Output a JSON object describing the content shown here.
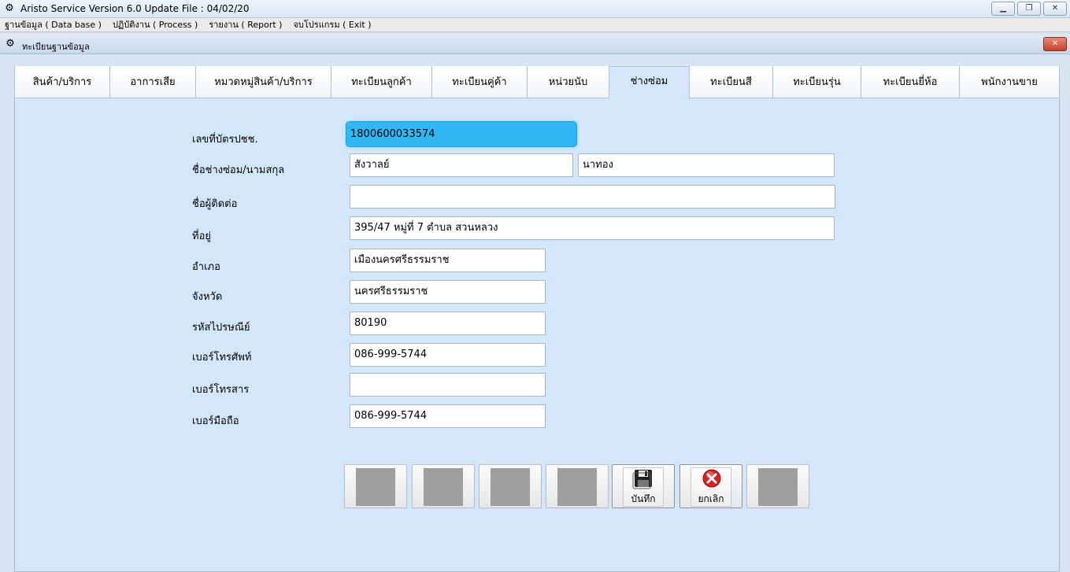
{
  "window": {
    "title": "Aristo Service Version 6.0 Update File : 04/02/20",
    "app_icon": "gear-icon",
    "minimize_glyph": "▁",
    "restore_glyph": "❐",
    "close_glyph": "✕"
  },
  "menu": [
    {
      "label": "ฐานข้อมูล ( Data base )"
    },
    {
      "label": "ปฏิบัติงาน ( Process )"
    },
    {
      "label": "รายงาน ( Report )"
    },
    {
      "label": "จบโปรแกรม ( Exit )"
    }
  ],
  "child_window": {
    "title": "ทะเบียนฐานข้อมูล",
    "icon": "gear-icon",
    "close_glyph": "✕"
  },
  "tabs": [
    {
      "label": "สินค้า/บริการ",
      "active": false
    },
    {
      "label": "อาการเสีย",
      "active": false
    },
    {
      "label": "หมวดหมู่สินค้า/บริการ",
      "active": false
    },
    {
      "label": "ทะเบียนลูกค้า",
      "active": false
    },
    {
      "label": "ทะเบียนคู่ค้า",
      "active": false
    },
    {
      "label": "หน่วยนับ",
      "active": false
    },
    {
      "label": "ช่างซ่อม",
      "active": true
    },
    {
      "label": "ทะเบียนสี",
      "active": false
    },
    {
      "label": "ทะเบียนรุ่น",
      "active": false
    },
    {
      "label": "ทะเบียนยี่ห้อ",
      "active": false
    },
    {
      "label": "พนักงานขาย",
      "active": false
    }
  ],
  "form": {
    "id_card": {
      "label": "เลขที่บัตรปชช.",
      "value": "1800600033574"
    },
    "name": {
      "label": "ชื่อช่างซ่อม/นามสกุล",
      "first": "สังวาลย์",
      "last": "นาทอง"
    },
    "contact": {
      "label": "ชื่อผู้ติดต่อ",
      "value": ""
    },
    "address": {
      "label": "ที่อยู่",
      "value": "395/47 หมู่ที่ 7 ตำบล สวนหลวง"
    },
    "district": {
      "label": "อำเภอ",
      "value": "เมืองนครศรีธรรมราช"
    },
    "province": {
      "label": "จังหวัด",
      "value": "นครศรีธรรมราช"
    },
    "postcode": {
      "label": "รหัสไปรษณีย์",
      "value": "80190"
    },
    "phone": {
      "label": "เบอร์โทรศัพท์",
      "value": "086-999-5744"
    },
    "fax": {
      "label": "เบอร์โทรสาร",
      "value": ""
    },
    "mobile": {
      "label": "เบอร์มือถือ",
      "value": "086-999-5744"
    }
  },
  "actions": {
    "save_label": "บันทึก",
    "save_icon": "floppy-disk-icon",
    "cancel_label": "ยกเลิก",
    "cancel_icon": "red-x-icon"
  },
  "colors": {
    "focus_field": "#30b8f5",
    "panel": "#d4e6fa"
  }
}
